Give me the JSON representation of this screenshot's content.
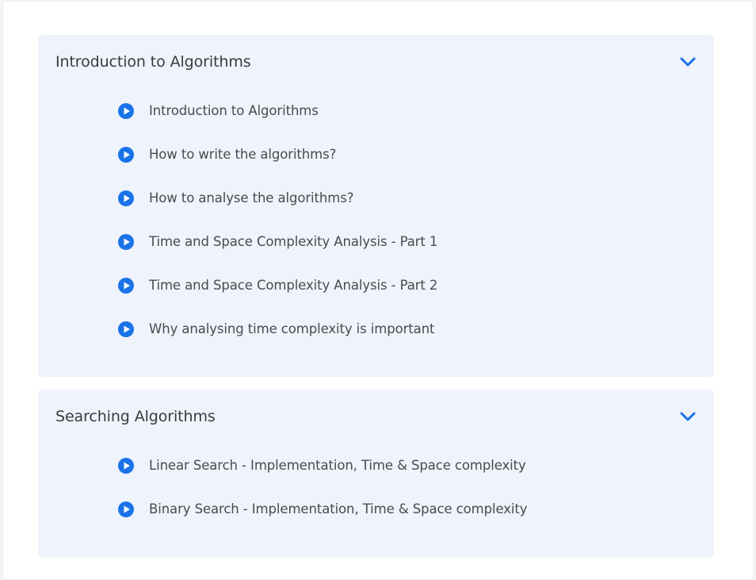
{
  "colors": {
    "accent": "#1a73e8",
    "section_bg": "#eff3fc",
    "text": "#4a4a4a"
  },
  "sections": [
    {
      "title": "Introduction to Algorithms",
      "toggle_icon": "chevron-down-icon",
      "lessons": [
        {
          "label": "Introduction to Algorithms",
          "icon": "play-circle-icon"
        },
        {
          "label": "How to write the algorithms?",
          "icon": "play-circle-icon"
        },
        {
          "label": "How to analyse the algorithms?",
          "icon": "play-circle-icon"
        },
        {
          "label": "Time and Space Complexity Analysis - Part 1",
          "icon": "play-circle-icon"
        },
        {
          "label": "Time and Space Complexity Analysis - Part 2",
          "icon": "play-circle-icon"
        },
        {
          "label": "Why analysing time complexity is important",
          "icon": "play-circle-icon"
        }
      ]
    },
    {
      "title": "Searching Algorithms",
      "toggle_icon": "chevron-down-icon",
      "lessons": [
        {
          "label": "Linear Search - Implementation, Time & Space complexity",
          "icon": "play-circle-icon"
        },
        {
          "label": "Binary Search - Implementation, Time & Space complexity",
          "icon": "play-circle-icon"
        }
      ]
    }
  ]
}
